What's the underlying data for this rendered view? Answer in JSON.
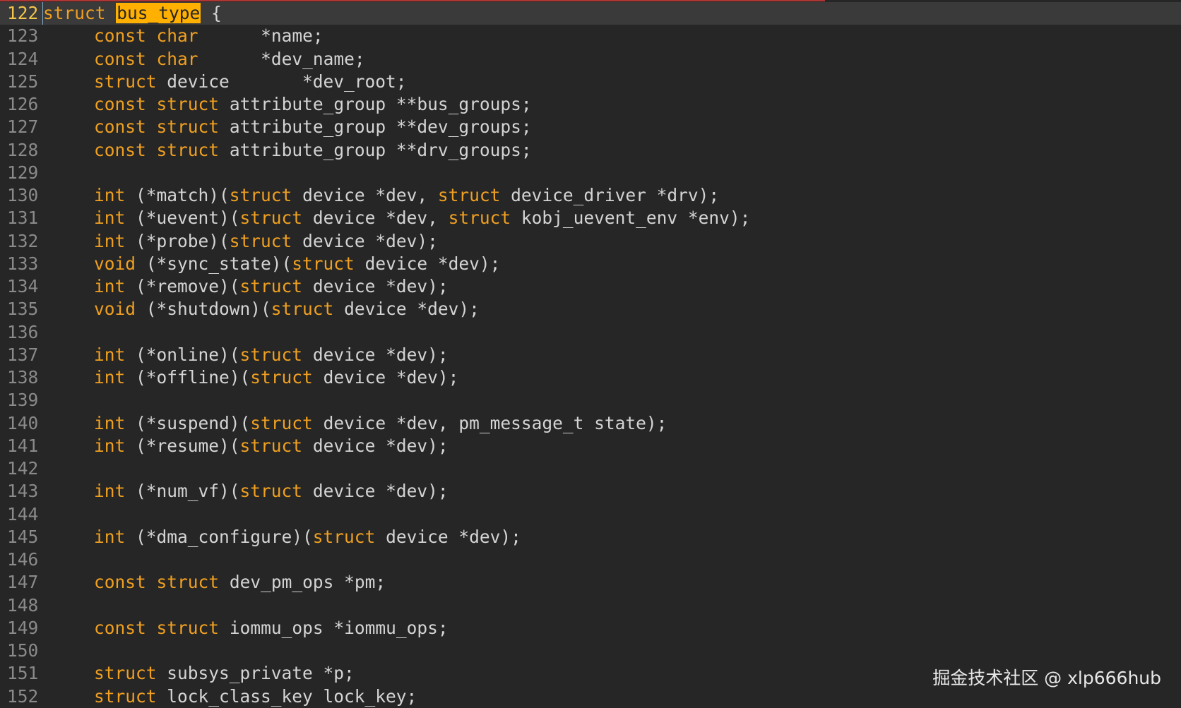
{
  "editor": {
    "current_line": 122,
    "watermark": "掘金技术社区 @ xlp666hub",
    "colors": {
      "background": "#262626",
      "current_line_background": "#3a3a3a",
      "keyword": "#f0a020",
      "text": "#d4d4d4",
      "line_number": "#8a8a8a",
      "current_line_number": "#f3c44a",
      "search_highlight": "#ffb000"
    },
    "lines": [
      {
        "n": "122",
        "tokens": [
          {
            "t": "struct",
            "k": "kw"
          },
          {
            "t": " "
          },
          {
            "t": "bus_type",
            "k": "hl"
          },
          {
            "t": " {"
          }
        ]
      },
      {
        "n": "123",
        "tokens": [
          {
            "t": "    "
          },
          {
            "t": "const",
            "k": "kw"
          },
          {
            "t": " "
          },
          {
            "t": "char",
            "k": "kw"
          },
          {
            "t": "      *name;"
          }
        ]
      },
      {
        "n": "124",
        "tokens": [
          {
            "t": "    "
          },
          {
            "t": "const",
            "k": "kw"
          },
          {
            "t": " "
          },
          {
            "t": "char",
            "k": "kw"
          },
          {
            "t": "      *dev_name;"
          }
        ]
      },
      {
        "n": "125",
        "tokens": [
          {
            "t": "    "
          },
          {
            "t": "struct",
            "k": "kw"
          },
          {
            "t": " device       *dev_root;"
          }
        ]
      },
      {
        "n": "126",
        "tokens": [
          {
            "t": "    "
          },
          {
            "t": "const",
            "k": "kw"
          },
          {
            "t": " "
          },
          {
            "t": "struct",
            "k": "kw"
          },
          {
            "t": " attribute_group **bus_groups;"
          }
        ]
      },
      {
        "n": "127",
        "tokens": [
          {
            "t": "    "
          },
          {
            "t": "const",
            "k": "kw"
          },
          {
            "t": " "
          },
          {
            "t": "struct",
            "k": "kw"
          },
          {
            "t": " attribute_group **dev_groups;"
          }
        ]
      },
      {
        "n": "128",
        "tokens": [
          {
            "t": "    "
          },
          {
            "t": "const",
            "k": "kw"
          },
          {
            "t": " "
          },
          {
            "t": "struct",
            "k": "kw"
          },
          {
            "t": " attribute_group **drv_groups;"
          }
        ]
      },
      {
        "n": "129",
        "tokens": []
      },
      {
        "n": "130",
        "tokens": [
          {
            "t": "    "
          },
          {
            "t": "int",
            "k": "kw"
          },
          {
            "t": " (*match)("
          },
          {
            "t": "struct",
            "k": "kw"
          },
          {
            "t": " device *dev, "
          },
          {
            "t": "struct",
            "k": "kw"
          },
          {
            "t": " device_driver *drv);"
          }
        ]
      },
      {
        "n": "131",
        "tokens": [
          {
            "t": "    "
          },
          {
            "t": "int",
            "k": "kw"
          },
          {
            "t": " (*uevent)("
          },
          {
            "t": "struct",
            "k": "kw"
          },
          {
            "t": " device *dev, "
          },
          {
            "t": "struct",
            "k": "kw"
          },
          {
            "t": " kobj_uevent_env *env);"
          }
        ]
      },
      {
        "n": "132",
        "tokens": [
          {
            "t": "    "
          },
          {
            "t": "int",
            "k": "kw"
          },
          {
            "t": " (*probe)("
          },
          {
            "t": "struct",
            "k": "kw"
          },
          {
            "t": " device *dev);"
          }
        ]
      },
      {
        "n": "133",
        "tokens": [
          {
            "t": "    "
          },
          {
            "t": "void",
            "k": "kw"
          },
          {
            "t": " (*sync_state)("
          },
          {
            "t": "struct",
            "k": "kw"
          },
          {
            "t": " device *dev);"
          }
        ]
      },
      {
        "n": "134",
        "tokens": [
          {
            "t": "    "
          },
          {
            "t": "int",
            "k": "kw"
          },
          {
            "t": " (*remove)("
          },
          {
            "t": "struct",
            "k": "kw"
          },
          {
            "t": " device *dev);"
          }
        ]
      },
      {
        "n": "135",
        "tokens": [
          {
            "t": "    "
          },
          {
            "t": "void",
            "k": "kw"
          },
          {
            "t": " (*shutdown)("
          },
          {
            "t": "struct",
            "k": "kw"
          },
          {
            "t": " device *dev);"
          }
        ]
      },
      {
        "n": "136",
        "tokens": []
      },
      {
        "n": "137",
        "tokens": [
          {
            "t": "    "
          },
          {
            "t": "int",
            "k": "kw"
          },
          {
            "t": " (*online)("
          },
          {
            "t": "struct",
            "k": "kw"
          },
          {
            "t": " device *dev);"
          }
        ]
      },
      {
        "n": "138",
        "tokens": [
          {
            "t": "    "
          },
          {
            "t": "int",
            "k": "kw"
          },
          {
            "t": " (*offline)("
          },
          {
            "t": "struct",
            "k": "kw"
          },
          {
            "t": " device *dev);"
          }
        ]
      },
      {
        "n": "139",
        "tokens": []
      },
      {
        "n": "140",
        "tokens": [
          {
            "t": "    "
          },
          {
            "t": "int",
            "k": "kw"
          },
          {
            "t": " (*suspend)("
          },
          {
            "t": "struct",
            "k": "kw"
          },
          {
            "t": " device *dev, pm_message_t state);"
          }
        ]
      },
      {
        "n": "141",
        "tokens": [
          {
            "t": "    "
          },
          {
            "t": "int",
            "k": "kw"
          },
          {
            "t": " (*resume)("
          },
          {
            "t": "struct",
            "k": "kw"
          },
          {
            "t": " device *dev);"
          }
        ]
      },
      {
        "n": "142",
        "tokens": []
      },
      {
        "n": "143",
        "tokens": [
          {
            "t": "    "
          },
          {
            "t": "int",
            "k": "kw"
          },
          {
            "t": " (*num_vf)("
          },
          {
            "t": "struct",
            "k": "kw"
          },
          {
            "t": " device *dev);"
          }
        ]
      },
      {
        "n": "144",
        "tokens": []
      },
      {
        "n": "145",
        "tokens": [
          {
            "t": "    "
          },
          {
            "t": "int",
            "k": "kw"
          },
          {
            "t": " (*dma_configure)("
          },
          {
            "t": "struct",
            "k": "kw"
          },
          {
            "t": " device *dev);"
          }
        ]
      },
      {
        "n": "146",
        "tokens": []
      },
      {
        "n": "147",
        "tokens": [
          {
            "t": "    "
          },
          {
            "t": "const",
            "k": "kw"
          },
          {
            "t": " "
          },
          {
            "t": "struct",
            "k": "kw"
          },
          {
            "t": " dev_pm_ops *pm;"
          }
        ]
      },
      {
        "n": "148",
        "tokens": []
      },
      {
        "n": "149",
        "tokens": [
          {
            "t": "    "
          },
          {
            "t": "const",
            "k": "kw"
          },
          {
            "t": " "
          },
          {
            "t": "struct",
            "k": "kw"
          },
          {
            "t": " iommu_ops *iommu_ops;"
          }
        ]
      },
      {
        "n": "150",
        "tokens": []
      },
      {
        "n": "151",
        "tokens": [
          {
            "t": "    "
          },
          {
            "t": "struct",
            "k": "kw"
          },
          {
            "t": " subsys_private *p;"
          }
        ]
      },
      {
        "n": "152",
        "tokens": [
          {
            "t": "    "
          },
          {
            "t": "struct",
            "k": "kw"
          },
          {
            "t": " lock_class_key lock_key;"
          }
        ]
      }
    ]
  }
}
